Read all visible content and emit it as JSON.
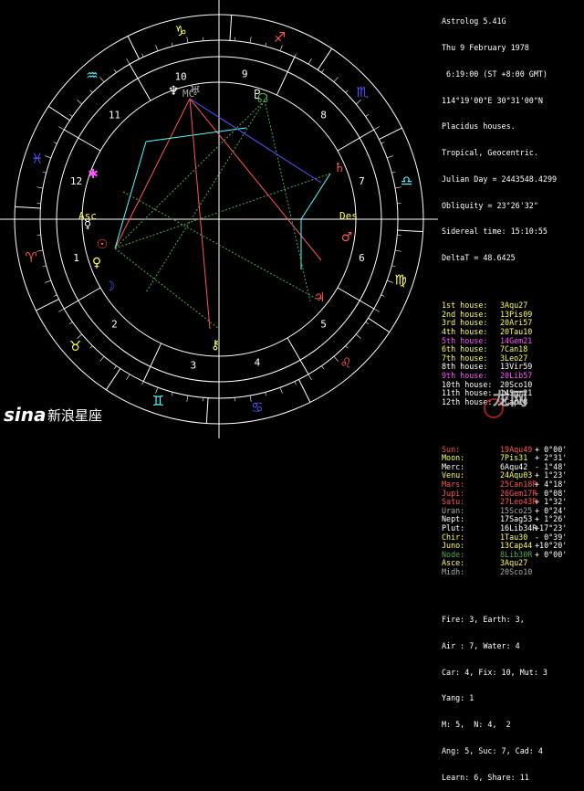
{
  "app": {
    "title": "Astrolog 5.41G"
  },
  "chart_info": {
    "date": "Thu 9 February 1978",
    "time": " 6:19:00 (ST +8:00 GMT)",
    "location": "114°19'00\"E 30°31'00\"N",
    "house_system": "Placidus houses.",
    "zodiac": "Tropical, Geocentric.",
    "julian_day": "Julian Day = 2443548.4299",
    "obliquity": "Obliquity = 23°26'32\"",
    "sidereal_time": "Sidereal time: 15:10:55",
    "delta_t": "DeltaT = 48.6425"
  },
  "houses": [
    {
      "label": "1st house:",
      "value": "3Aqu27",
      "color": "#ffff55"
    },
    {
      "label": "2nd house:",
      "value": "13Pis09",
      "color": "#ffff55"
    },
    {
      "label": "3rd house:",
      "value": "20Ari57",
      "color": "#ffff55"
    },
    {
      "label": "4th house:",
      "value": "20Tau10",
      "color": "#ffff55"
    },
    {
      "label": "5th house:",
      "value": "14Gem21",
      "color": "#ff55ff"
    },
    {
      "label": "6th house:",
      "value": "7Can18",
      "color": "#ffff55"
    },
    {
      "label": "7th house:",
      "value": "3Leo27",
      "color": "#ffff55"
    },
    {
      "label": "8th house:",
      "value": "13Vir59",
      "color": "#ffffff"
    },
    {
      "label": "9th house:",
      "value": "20Lib57",
      "color": "#ff55ff"
    },
    {
      "label": "10th house:",
      "value": "20Sco10",
      "color": "#ffffff"
    },
    {
      "label": "11th house:",
      "value": "14Sgr21",
      "color": "#ffffff"
    },
    {
      "label": "12th house:",
      "value": "7Cap18",
      "color": "#ffffff"
    }
  ],
  "planets": [
    {
      "label": "Sun:",
      "value": "19Aqu49",
      "motion": "+ 0°00'",
      "color": "#ff5555"
    },
    {
      "label": "Moon:",
      "value": "7Pis31",
      "motion": "+ 2°31'",
      "color": "#ffff55"
    },
    {
      "label": "Merc:",
      "value": "6Aqu42",
      "motion": "- 1°48'",
      "color": "#ffffff"
    },
    {
      "label": "Venu:",
      "value": "24Aqu03",
      "motion": "+ 1°23'",
      "color": "#ffff55"
    },
    {
      "label": "Mars:",
      "value": "25Can18R",
      "motion": "+ 4°18'",
      "color": "#ff5555"
    },
    {
      "label": "Jupi:",
      "value": "26Gem17R",
      "motion": "- 0°08'",
      "color": "#ff5555"
    },
    {
      "label": "Satu:",
      "value": "27Leo43R",
      "motion": "+ 1°32'",
      "color": "#ff5555"
    },
    {
      "label": "Uran:",
      "value": "15Sco25",
      "motion": "+ 0°24'",
      "color": "#aaaaaa"
    },
    {
      "label": "Nept:",
      "value": "17Sag53",
      "motion": "+ 1°26'",
      "color": "#ffffff"
    },
    {
      "label": "Plut:",
      "value": "16Lib34R",
      "motion": "+17°23'",
      "color": "#ffffff"
    },
    {
      "label": "Chir:",
      "value": "1Tau30",
      "motion": "- 0°39'",
      "color": "#ffff55"
    },
    {
      "label": "Juno:",
      "value": "13Cap44",
      "motion": "+10°20'",
      "color": "#ffff55"
    },
    {
      "label": "Node:",
      "value": "8Lib30R",
      "motion": "+ 0°00'",
      "color": "#55aa55"
    },
    {
      "label": "Asce:",
      "value": "3Aqu27",
      "motion": "",
      "color": "#ffff55"
    },
    {
      "label": "Midh:",
      "value": "20Sco10",
      "motion": "",
      "color": "#aaaaaa"
    }
  ],
  "element_summary": {
    "line1": "Fire: 3, Earth: 3,",
    "line2": "Air : 7, Water: 4",
    "line3": "Car: 4, Fix: 10, Mut: 3",
    "line4": "Yang: 1",
    "line5": "M: 5,  N: 4,  2",
    "line6": "Ang: 5, Suc: 7, Cad: 4",
    "line7": "Learn: 6, Share: 11"
  },
  "wheel": {
    "signs": [
      "Aries",
      "Taurus",
      "Gemini",
      "Cancer",
      "Leo",
      "Virgo",
      "Libra",
      "Scorpio",
      "Sagittarius",
      "Capricorn",
      "Aquarius",
      "Pisces"
    ],
    "sign_glyphs": [
      "♈",
      "♉",
      "♊",
      "♋",
      "♌",
      "♍",
      "♎",
      "♏",
      "♐",
      "♑",
      "♒",
      "♓"
    ],
    "sign_colors": [
      "#ff5555",
      "#ffff55",
      "#55ffff",
      "#5555ff",
      "#ff5555",
      "#ffff55",
      "#55ffff",
      "#5555ff",
      "#ff5555",
      "#ffff55",
      "#55ffff",
      "#5555ff"
    ],
    "house_numbers": [
      "1",
      "2",
      "3",
      "4",
      "5",
      "6",
      "7",
      "8",
      "9",
      "10",
      "11",
      "12"
    ],
    "asc_label": "Asc",
    "des_label": "Des",
    "mc_label": "MC",
    "ic_label": "IC"
  },
  "watermarks": {
    "sina_logo": "sina",
    "sina_text": "新浪星座",
    "site_text": "龙网"
  }
}
